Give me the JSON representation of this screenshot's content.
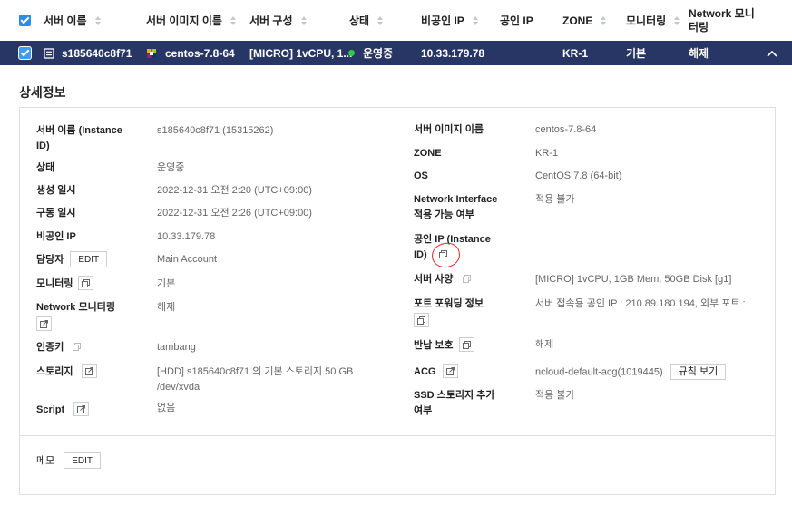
{
  "table": {
    "columns": [
      "서버 이름",
      "서버 이미지 이름",
      "서버 구성",
      "상태",
      "비공인 IP",
      "공인 IP",
      "ZONE",
      "모니터링",
      "Network 모니\n터링"
    ],
    "row": {
      "name": "s185640c8f71",
      "image": "centos-7.8-64",
      "spec": "[MICRO] 1vCPU, 1...",
      "status": "운영중",
      "status_color": "#2ecc40",
      "private_ip": "10.33.179.78",
      "public_ip": "",
      "zone": "KR-1",
      "monitoring": "기본",
      "network_monitoring": "해제"
    }
  },
  "detail": {
    "title": "상세정보",
    "edit_label": "EDIT",
    "left": {
      "server_name_label": "서버 이름 (Instance\nID)",
      "server_name_value": "s185640c8f71 (15315262)",
      "status_label": "상태",
      "status_value": "운영중",
      "created_label": "생성 일시",
      "created_value": "2022-12-31 오전 2:20 (UTC+09:00)",
      "started_label": "구동 일시",
      "started_value": "2022-12-31 오전 2:26 (UTC+09:00)",
      "private_ip_label": "비공인 IP",
      "private_ip_value": "10.33.179.78",
      "owner_label": "담당자",
      "owner_value": "Main Account",
      "monitoring_label": "모니터링",
      "monitoring_value": "기본",
      "net_monitoring_label": "Network 모니터링",
      "net_monitoring_value": "해제",
      "auth_key_label": "인증키",
      "auth_key_value": "tambang",
      "storage_label": "스토리지",
      "storage_value": "[HDD] s185640c8f71 의 기본 스토리지  50 GB\n/dev/xvda",
      "script_label": "Script",
      "script_value": "없음"
    },
    "right": {
      "image_label": "서버 이미지 이름",
      "image_value": "centos-7.8-64",
      "zone_label": "ZONE",
      "zone_value": "KR-1",
      "os_label": "OS",
      "os_value": "CentOS 7.8 (64-bit)",
      "ni_label": "Network Interface\n적용 가능 여부",
      "ni_value": "적용 불가",
      "public_ip_label": "공인 IP (Instance\nID)",
      "spec_label": "서버 사양",
      "spec_value": "[MICRO] 1vCPU, 1GB Mem, 50GB Disk [g1]",
      "port_label": "포트 포워딩 정보",
      "port_value": "서버 접속용 공인 IP : 210.89.180.194, 외부 포트 :",
      "return_label": "반납 보호",
      "return_value": "해제",
      "acg_label": "ACG",
      "acg_value": "ncloud-default-acg(1019445)",
      "rule_button": "규칙 보기",
      "ssd_label": "SSD 스토리지 추가\n여부",
      "ssd_value": "적용 불가"
    },
    "memo_label": "메모"
  },
  "colors": {
    "header_row_bg": "#283665",
    "accent": "#2c8be6",
    "annotation": "#d9262c"
  }
}
